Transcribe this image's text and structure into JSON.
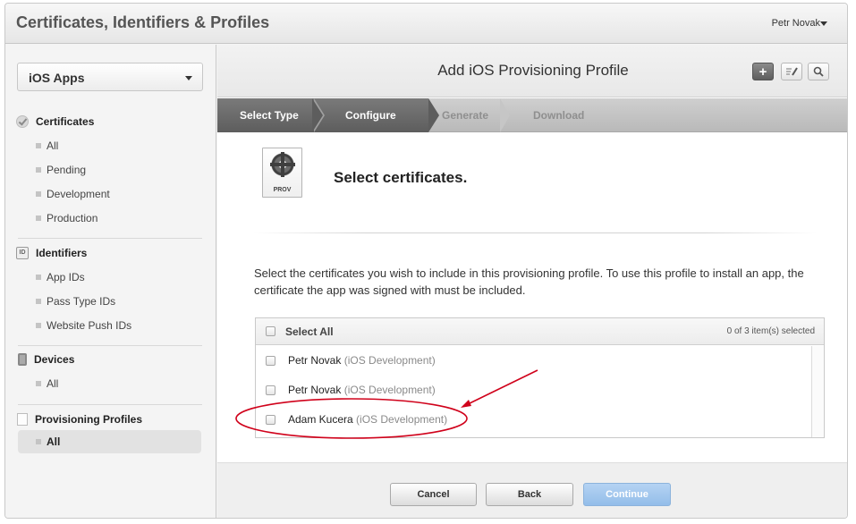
{
  "header": {
    "title": "Certificates, Identifiers & Profiles",
    "user": "Petr Novak"
  },
  "sidebar": {
    "app_select": "iOS Apps",
    "sections": [
      {
        "label": "Certificates",
        "icon": "certificate-icon",
        "items": [
          "All",
          "Pending",
          "Development",
          "Production"
        ]
      },
      {
        "label": "Identifiers",
        "icon": "id-badge-icon",
        "icon_text": "ID",
        "items": [
          "App IDs",
          "Pass Type IDs",
          "Website Push IDs"
        ]
      },
      {
        "label": "Devices",
        "icon": "device-icon",
        "items": [
          "All"
        ]
      },
      {
        "label": "Provisioning Profiles",
        "icon": "profile-document-icon",
        "items": [
          "All"
        ],
        "active_item": "All"
      }
    ]
  },
  "main": {
    "page_title": "Add iOS Provisioning Profile",
    "toolbar": {
      "add_icon": "plus-icon",
      "edit_icon": "edit-icon",
      "search_icon": "search-icon"
    },
    "wizard": {
      "steps": [
        "Select Type",
        "Configure",
        "Generate",
        "Download"
      ],
      "active_step": "Configure"
    },
    "icon_label": "PROV",
    "heading": "Select certificates.",
    "description": "Select the certificates you wish to include in this provisioning profile. To use this profile to install an app, the certificate the app was signed with must be included.",
    "cert_list": {
      "select_all": "Select All",
      "selected_count": "0 of 3 item(s) selected",
      "items": [
        {
          "name": "Petr Novak",
          "type": "(iOS Development)"
        },
        {
          "name": "Petr Novak",
          "type": "(iOS Development)"
        },
        {
          "name": "Adam Kucera",
          "type": "(iOS Development)"
        }
      ]
    },
    "buttons": {
      "cancel": "Cancel",
      "back": "Back",
      "continue": "Continue"
    }
  },
  "colors": {
    "annotation": "#d0021b",
    "continue_button": "#9fc5ee",
    "wizard_active": "#6a6a6a"
  }
}
